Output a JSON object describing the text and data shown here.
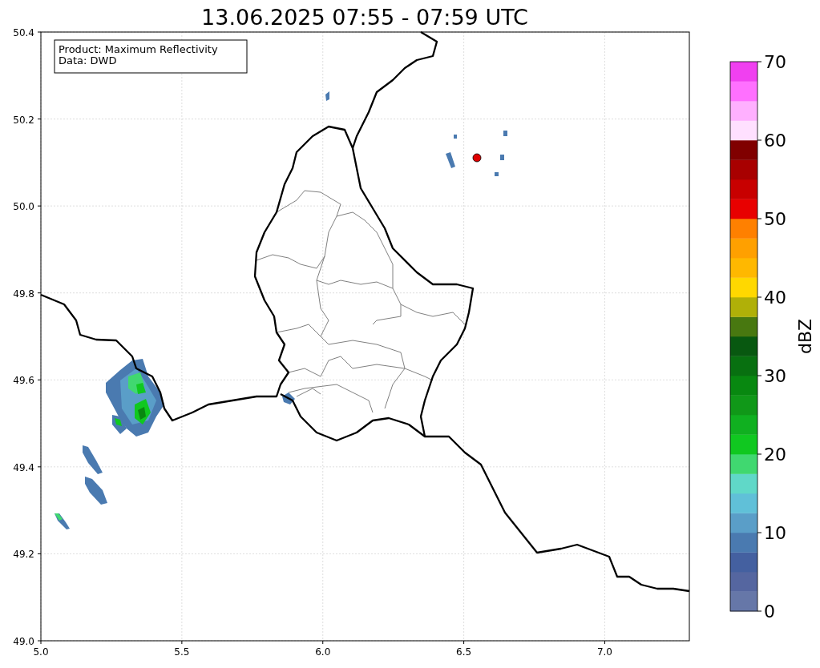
{
  "title": "13.06.2025 07:55 - 07:59 UTC",
  "info_box": [
    "Product: Maximum Reflectivity",
    "Data: DWD"
  ],
  "map": {
    "xticks": [
      "5.0",
      "5.5",
      "6.0",
      "6.5",
      "7.0"
    ],
    "yticks": [
      "50.4",
      "50.2",
      "50.0",
      "49.8",
      "49.6",
      "49.4",
      "49.2",
      "49.0"
    ]
  },
  "colorbar": {
    "label": "dBZ",
    "ticks": [
      "70",
      "60",
      "50",
      "40",
      "30",
      "20",
      "10",
      "0"
    ],
    "levels": [
      {
        "color": "#6677a8"
      },
      {
        "color": "#5566a0"
      },
      {
        "color": "#4460a0"
      },
      {
        "color": "#4a7ab0"
      },
      {
        "color": "#5a9ec8"
      },
      {
        "color": "#60c0d8"
      },
      {
        "color": "#60d8c8"
      },
      {
        "color": "#40d870"
      },
      {
        "color": "#10c820"
      },
      {
        "color": "#10b020"
      },
      {
        "color": "#109818"
      },
      {
        "color": "#088810"
      },
      {
        "color": "#087010"
      },
      {
        "color": "#085810"
      },
      {
        "color": "#487810"
      },
      {
        "color": "#b0b008"
      },
      {
        "color": "#ffd800"
      },
      {
        "color": "#ffb800"
      },
      {
        "color": "#ffa000"
      },
      {
        "color": "#ff8000"
      },
      {
        "color": "#e80000"
      },
      {
        "color": "#c80000"
      },
      {
        "color": "#a80000"
      },
      {
        "color": "#800000"
      },
      {
        "color": "#ffe0ff"
      },
      {
        "color": "#ffb0ff"
      },
      {
        "color": "#ff70ff"
      },
      {
        "color": "#f040f0"
      }
    ]
  }
}
